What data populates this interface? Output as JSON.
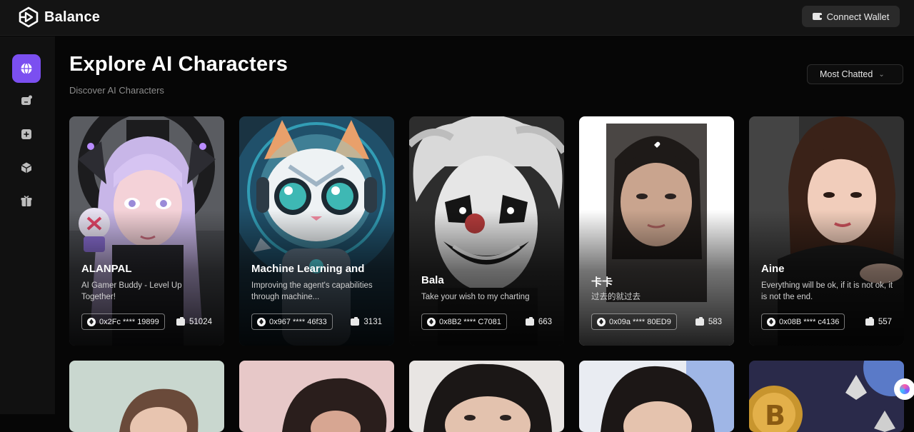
{
  "app": {
    "name": "Balance"
  },
  "header": {
    "connect_label": "Connect Wallet"
  },
  "sidebar": {
    "items": [
      {
        "icon": "globe-icon",
        "active": true
      },
      {
        "icon": "chat-plus-icon",
        "active": false
      },
      {
        "icon": "plus-square-icon",
        "active": false
      },
      {
        "icon": "cube-icon",
        "active": false
      },
      {
        "icon": "gift-icon",
        "active": false
      }
    ]
  },
  "page": {
    "title": "Explore AI Characters",
    "subtitle": "Discover AI Characters",
    "sort": {
      "selected": "Most Chatted"
    }
  },
  "cards": [
    {
      "name": "ALANPAL",
      "description": "AI Gamer Buddy - Level Up Together!",
      "address": "0x2Fc **** 19899",
      "chats": "51024"
    },
    {
      "name": "Machine Learning and",
      "description": "Improving the agent's capabilities through machine...",
      "address": "0x967 **** 46f33",
      "chats": "3131"
    },
    {
      "name": "Bala",
      "description": "Take your wish to my charting",
      "address": "0x8B2 **** C7081",
      "chats": "663"
    },
    {
      "name": "卡卡",
      "description": "过去的就过去",
      "address": "0x09a **** 80ED9",
      "chats": "583"
    },
    {
      "name": "Aine",
      "description": "Everything will be ok, if it is not ok, it is not the end.",
      "address": "0x08B **** c4136",
      "chats": "557"
    }
  ],
  "colors": {
    "accent": "#7b4ff0",
    "background": "#060606",
    "panel": "#141414"
  }
}
